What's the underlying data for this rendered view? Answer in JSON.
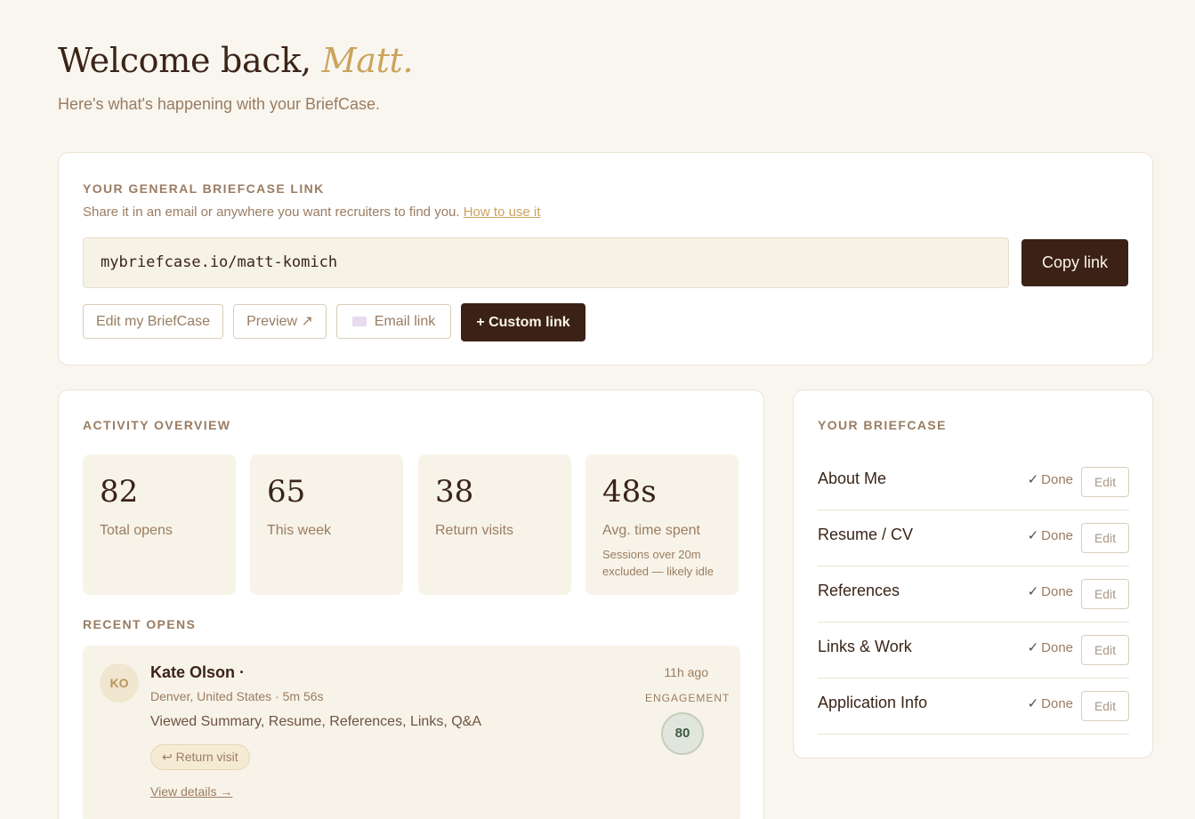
{
  "header": {
    "greeting": "Welcome back,",
    "name": "Matt.",
    "subtitle": "Here's what's happening with your BriefCase."
  },
  "link_card": {
    "title": "YOUR GENERAL BRIEFCASE LINK",
    "description": "Share it in an email or anywhere you want recruiters to find you.",
    "how_to_label": "How to use it",
    "url": "mybriefcase.io/matt-komich",
    "copy_label": "Copy link",
    "edit_label": "Edit my BriefCase",
    "preview_label": "Preview ↗",
    "email_label": "Email link",
    "custom_label": "+ Custom link"
  },
  "activity": {
    "title": "ACTIVITY OVERVIEW",
    "stats": [
      {
        "value": "82",
        "label": "Total opens"
      },
      {
        "value": "65",
        "label": "This week"
      },
      {
        "value": "38",
        "label": "Return visits"
      },
      {
        "value": "48s",
        "label": "Avg. time spent",
        "note": "Sessions over 20m excluded — likely idle"
      }
    ],
    "recent_title": "RECENT OPENS",
    "recent": [
      {
        "initials": "KO",
        "name": "Kate Olson ·",
        "meta": "Denver, United States · 5m 56s",
        "viewed": "Viewed Summary, Resume, References, Links, Q&A",
        "badge": "↩ Return visit",
        "details_label": "View details →",
        "time_ago": "11h ago",
        "engagement_label": "ENGAGEMENT",
        "engagement_score": "80"
      }
    ]
  },
  "briefcase": {
    "title": "YOUR BRIEFCASE",
    "items": [
      {
        "name": "About Me",
        "status": "Done",
        "edit_label": "Edit"
      },
      {
        "name": "Resume / CV",
        "status": "Done",
        "edit_label": "Edit"
      },
      {
        "name": "References",
        "status": "Done",
        "edit_label": "Edit"
      },
      {
        "name": "Links & Work",
        "status": "Done",
        "edit_label": "Edit"
      },
      {
        "name": "Application Info",
        "status": "Done",
        "edit_label": "Edit"
      }
    ],
    "check_glyph": "✓"
  },
  "colors": {
    "background": "#f9f6ef",
    "accent_gold": "#c9a45c",
    "dark_brown": "#3b2116",
    "muted_text": "#9a7c61",
    "done_green": "#3d5a45"
  }
}
